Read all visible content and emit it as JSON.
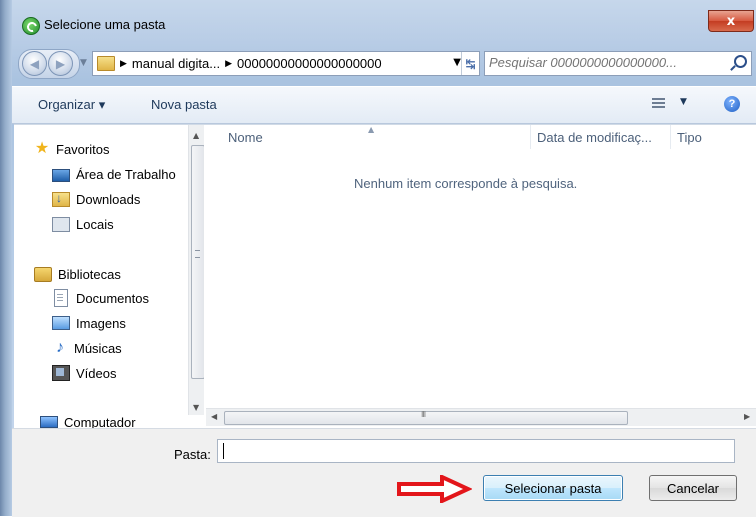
{
  "window": {
    "title": "Selecione uma pasta",
    "close_label": "x"
  },
  "address_bar": {
    "breadcrumbs": [
      "manual digita...",
      "00000000000000000000"
    ],
    "search_placeholder": "Pesquisar 0000000000000000..."
  },
  "toolbar": {
    "organize_label": "Organizar ▾",
    "new_folder_label": "Nova pasta"
  },
  "nav_pane": {
    "items": [
      {
        "label": "Favoritos",
        "icon": "star-icon"
      },
      {
        "label": "Área de Trabalho",
        "icon": "desktop-icon"
      },
      {
        "label": "Downloads",
        "icon": "downloads-icon"
      },
      {
        "label": "Locais",
        "icon": "places-icon"
      },
      {
        "label": "Bibliotecas",
        "icon": "library-icon"
      },
      {
        "label": "Documentos",
        "icon": "document-icon"
      },
      {
        "label": "Imagens",
        "icon": "image-icon"
      },
      {
        "label": "Músicas",
        "icon": "music-icon"
      },
      {
        "label": "Vídeos",
        "icon": "video-icon"
      },
      {
        "label": "Computador",
        "icon": "computer-icon"
      }
    ]
  },
  "file_list": {
    "columns": [
      "Nome",
      "Data de modificaç...",
      "Tipo"
    ],
    "empty_message": "Nenhum item corresponde à pesquisa."
  },
  "footer": {
    "folder_label": "Pasta:",
    "folder_value": "",
    "select_button": "Selecionar pasta",
    "cancel_button": "Cancelar"
  },
  "colors": {
    "annotation_arrow": "#e3161b",
    "accent": "#3c7fb1"
  }
}
